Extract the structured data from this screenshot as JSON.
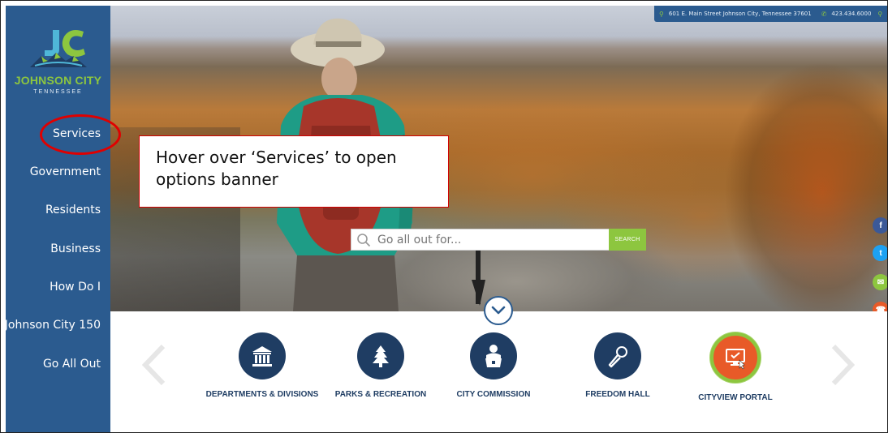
{
  "header": {
    "address": "601 E. Main Street Johnson City, Tennessee 37601",
    "phone": "423.434.6000"
  },
  "logo": {
    "name": "JOHNSON CITY",
    "subtitle": "TENNESSEE"
  },
  "nav": {
    "items": [
      {
        "label": "Services"
      },
      {
        "label": "Government"
      },
      {
        "label": "Residents"
      },
      {
        "label": "Business"
      },
      {
        "label": "How Do I"
      },
      {
        "label": "Johnson City 150"
      },
      {
        "label": "Go All Out"
      }
    ]
  },
  "callout": {
    "text": "Hover over ‘Services’ to open options banner"
  },
  "search": {
    "placeholder": "Go all out for...",
    "button_label": "SEARCH"
  },
  "social": [
    {
      "name": "facebook",
      "glyph": "f",
      "color": "#3b5998"
    },
    {
      "name": "twitter",
      "glyph": "t",
      "color": "#1da1f2"
    },
    {
      "name": "email",
      "glyph": "✉",
      "color": "#8dc63f"
    },
    {
      "name": "phone",
      "glyph": "☎",
      "color": "#e85a28"
    }
  ],
  "quick_links": [
    {
      "label": "DEPARTMENTS & DIVISIONS",
      "icon": "building-icon"
    },
    {
      "label": "PARKS & RECREATION",
      "icon": "tree-icon"
    },
    {
      "label": "CITY COMMISSION",
      "icon": "person-podium-icon"
    },
    {
      "label": "FREEDOM HALL",
      "icon": "microphone-icon"
    },
    {
      "label": "CITYVIEW PORTAL",
      "icon": "monitor-check-icon"
    }
  ],
  "colors": {
    "brand_blue": "#2b5b8f",
    "brand_green": "#8dc63f",
    "dark_navy": "#1f3d63",
    "accent_orange": "#e85a28",
    "annotation_red": "#e00000"
  }
}
